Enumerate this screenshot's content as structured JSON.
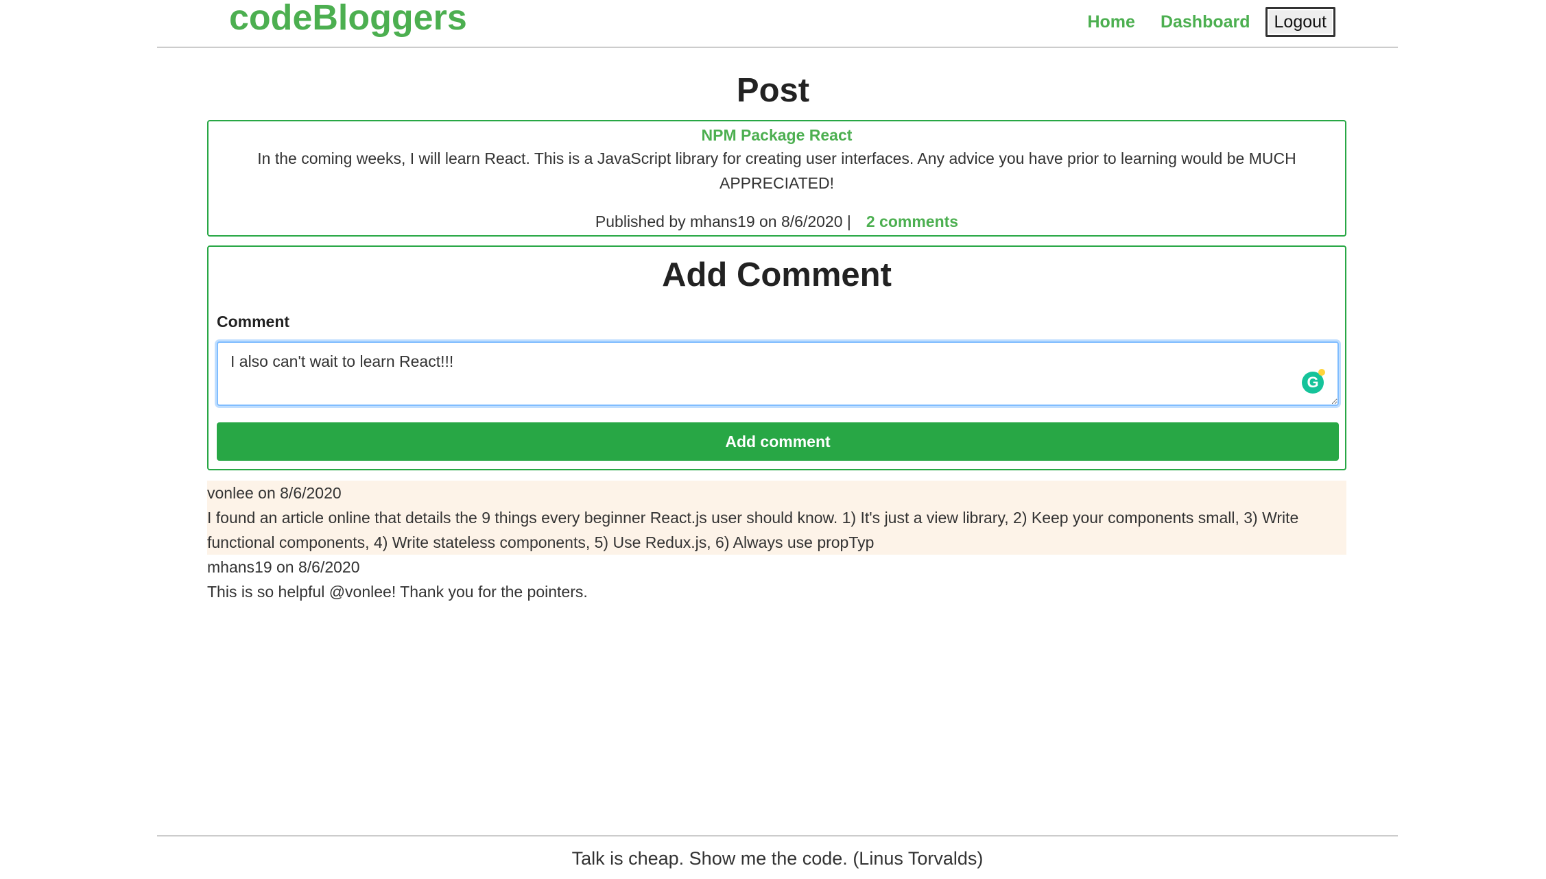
{
  "header": {
    "brand": "codeBloggers",
    "nav": {
      "home": "Home",
      "dashboard": "Dashboard",
      "logout": "Logout"
    }
  },
  "main": {
    "title": "Post",
    "post": {
      "title": "NPM Package React",
      "body": "In the coming weeks, I will learn React. This is a JavaScript library for creating user interfaces. Any advice you have prior to learning would be MUCH APPRECIATED!",
      "meta": "Published by mhans19 on 8/6/2020 |",
      "comments_link": "2 comments"
    },
    "add_comment": {
      "heading": "Add Comment",
      "label": "Comment",
      "value": "I also can't wait to learn React!!!",
      "grammarly_glyph": "G",
      "button": "Add comment"
    },
    "comments": [
      {
        "byline": "vonlee on 8/6/2020",
        "text": "I found an article online that details the 9 things every beginner React.js user should know. 1) It's just a view library, 2) Keep your components small, 3) Write functional components, 4) Write stateless components, 5) Use Redux.js, 6) Always use propTyp"
      },
      {
        "byline": "mhans19 on 8/6/2020",
        "text": "This is so helpful @vonlee! Thank you for the pointers."
      }
    ]
  },
  "footer": {
    "quote": "Talk is cheap. Show me the code. (Linus Torvalds)"
  },
  "colors": {
    "brand_green": "#4caf50",
    "button_green": "#28a745",
    "highlight_bg": "#fdf3e8"
  }
}
